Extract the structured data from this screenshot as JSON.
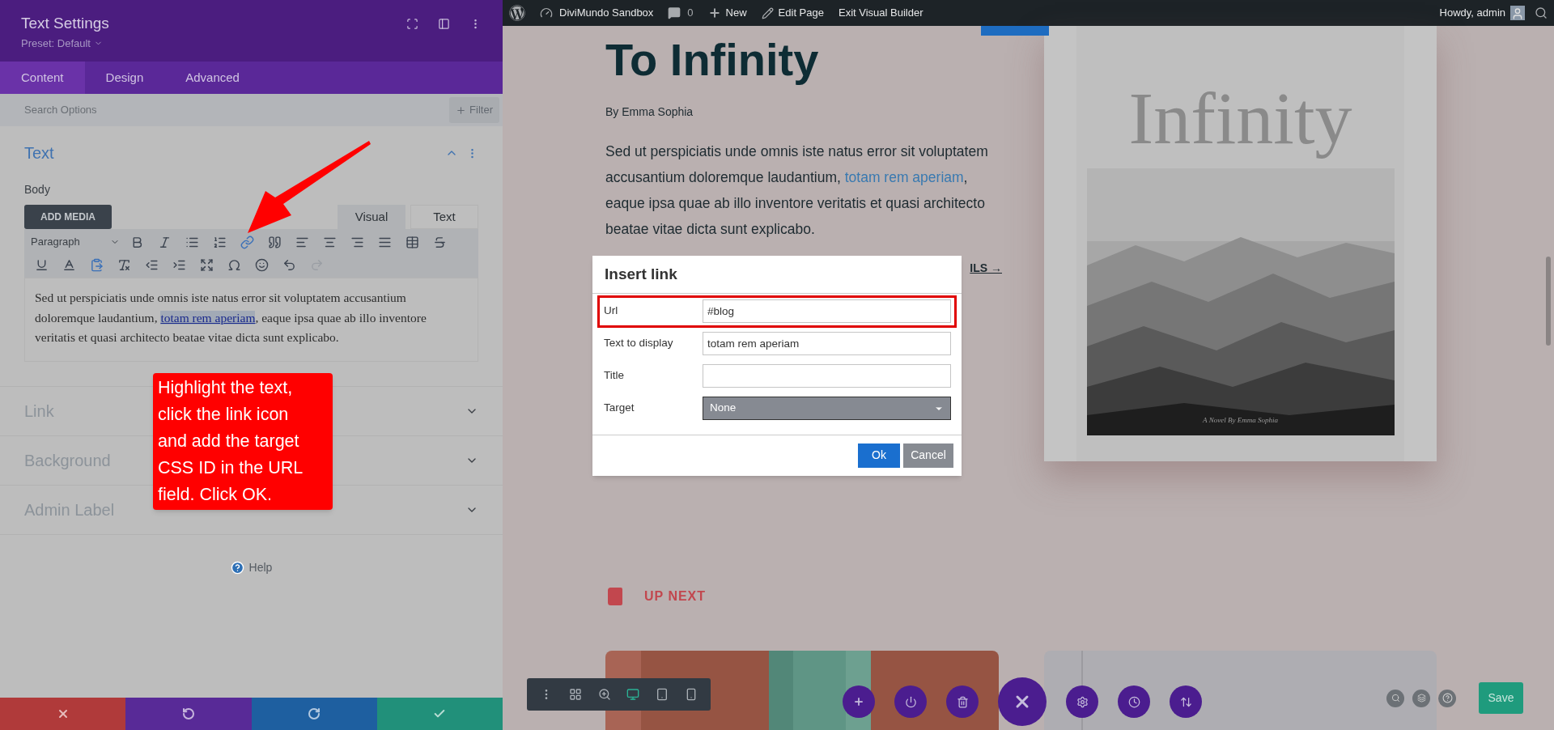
{
  "panel": {
    "title": "Text Settings",
    "preset": "Preset: Default",
    "tabs": [
      {
        "label": "Content",
        "selected": true
      },
      {
        "label": "Design",
        "selected": false
      },
      {
        "label": "Advanced",
        "selected": false
      }
    ],
    "search": {
      "placeholder": "Search Options"
    },
    "filter_button": "Filter",
    "section": {
      "title": "Text",
      "expanded": true,
      "body_label": "Body",
      "add_media": "ADD MEDIA",
      "editor_tabs": [
        {
          "label": "Visual",
          "selected": true
        },
        {
          "label": "Text",
          "selected": false
        }
      ],
      "format_select": "Paragraph",
      "content": {
        "before": "Sed ut perspiciatis unde omnis iste natus error sit voluptatem accusantium doloremque laudantium, ",
        "link": "totam rem aperiam",
        "link_selected": true,
        "after": ", eaque ipsa quae ab illo inventore veritatis et quasi architecto beatae vitae dicta sunt explicabo."
      }
    },
    "collapsed_sections": [
      {
        "title": "Link",
        "expanded": false
      },
      {
        "title": "Background",
        "expanded": false
      },
      {
        "title": "Admin Label",
        "expanded": false
      }
    ],
    "help": "Help"
  },
  "admin_bar": {
    "site": "DiviMundo Sandbox",
    "comments": "0",
    "new": "New",
    "edit": "Edit Page",
    "exit": "Exit Visual Builder",
    "greeting": "Howdy, admin"
  },
  "article": {
    "title": "To Infinity",
    "byline": "By Emma Sophia",
    "paragraph": {
      "before": "Sed ut perspiciatis unde omnis iste natus error sit voluptatem accusantium doloremque laudantium, ",
      "link": "totam rem aperiam",
      "after": ", eaque ipsa quae ab illo inventore veritatis et quasi architecto beatae vitae dicta sunt explicabo."
    },
    "more_link": "ILS →"
  },
  "cover": {
    "title": "Infinity",
    "caption": "A Novel By Emma Sophia"
  },
  "up_next": "UP NEXT",
  "dialog": {
    "title": "Insert link",
    "fields": [
      {
        "kind": "text",
        "label": "Url",
        "value": "#blog",
        "highlighted": true
      },
      {
        "kind": "text",
        "label": "Text to display",
        "value": "totam rem aperiam",
        "highlighted": false
      },
      {
        "kind": "text",
        "label": "Title",
        "highlighted": false
      },
      {
        "kind": "select",
        "label": "Target",
        "value": "None",
        "highlighted": false
      }
    ],
    "ok": "Ok",
    "cancel": "Cancel"
  },
  "annotation": "Highlight the text, click the link icon and add the target CSS ID in the URL field. Click OK.",
  "builder": {
    "views": [
      {
        "kind": "desktop",
        "selected": true
      },
      {
        "kind": "tablet",
        "selected": false
      },
      {
        "kind": "phone",
        "selected": false
      }
    ],
    "save": "Save"
  }
}
